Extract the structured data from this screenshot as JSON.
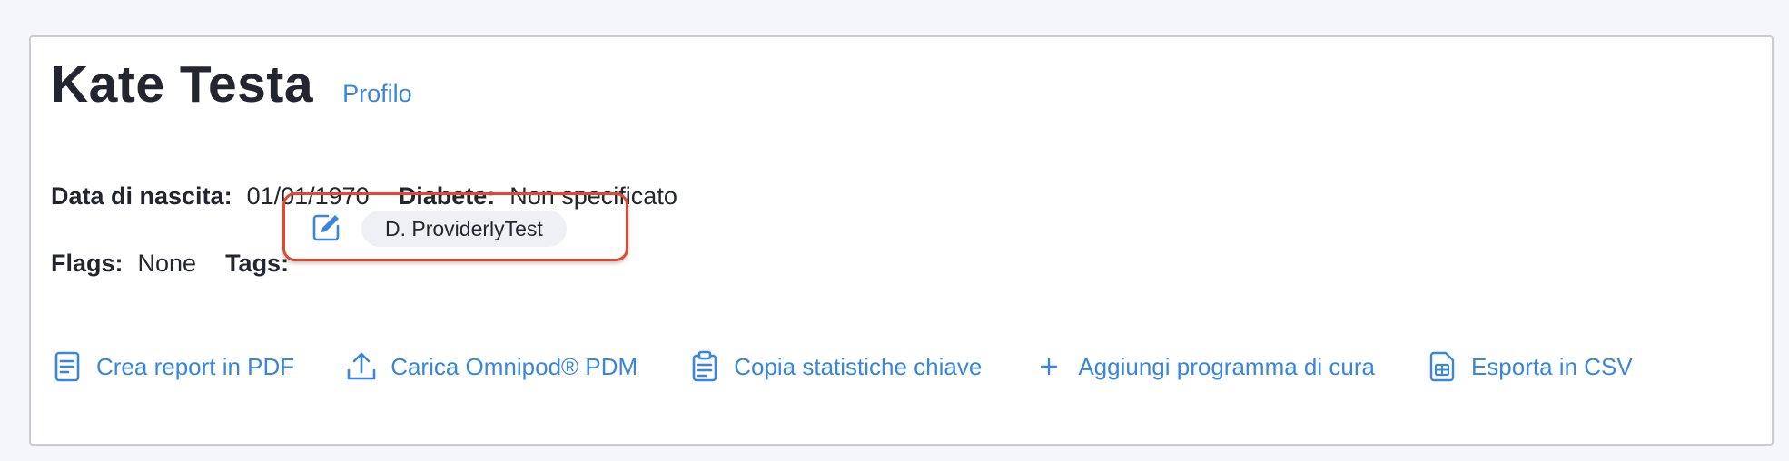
{
  "patient": {
    "name": "Kate Testa",
    "profile_link": "Profilo",
    "birth_label": "Data di nascita:",
    "birth_value": "01/01/1970",
    "diabetes_label": "Diabete:",
    "diabetes_value": "Non specificato",
    "flags_label": "Flags:",
    "flags_value": "None",
    "tags_label": "Tags:",
    "tags": [
      "D. ProviderlyTest"
    ]
  },
  "actions": [
    {
      "label": "Crea report in PDF",
      "icon": "pdf-report-icon"
    },
    {
      "label": "Carica Omnipod® PDM",
      "icon": "upload-icon"
    },
    {
      "label": "Copia statistiche chiave",
      "icon": "clipboard-icon"
    },
    {
      "label": "Aggiungi programma di cura",
      "icon": "plus-icon"
    },
    {
      "label": "Esporta in CSV",
      "icon": "csv-file-icon"
    }
  ],
  "colors": {
    "accent": "#3a86d9",
    "highlight_border": "#e0492f",
    "chip_bg": "#eef0f4",
    "page_bg": "#f5f6fa"
  }
}
